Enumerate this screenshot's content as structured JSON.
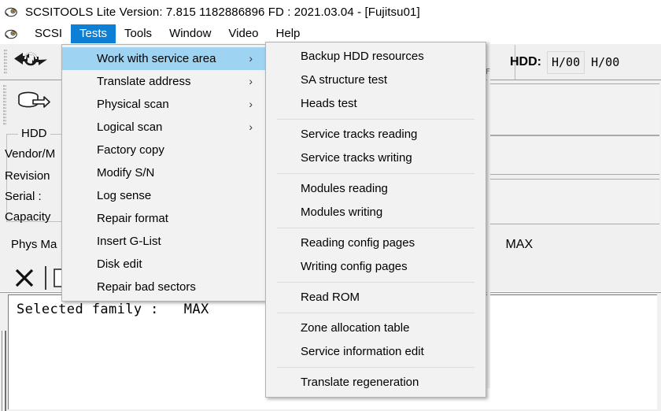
{
  "window": {
    "title": "SCSITOOLS Lite Version: 7.815   1182886896 FD : 2021.03.04 - [Fujitsu01]",
    "app_icon": "scsi-tools-icon",
    "accent_color": "#0d7fd4",
    "highlight_color": "#9fd3f2"
  },
  "menubar": {
    "icon": "scsi-tools-icon",
    "items": [
      {
        "label": "SCSI",
        "active": false
      },
      {
        "label": "Tests",
        "active": true
      },
      {
        "label": "Tools",
        "active": false
      },
      {
        "label": "Window",
        "active": false
      },
      {
        "label": "Video",
        "active": false
      },
      {
        "label": "Help",
        "active": false
      }
    ]
  },
  "toolbar": {
    "swap_icon": "double-arrow-swap-icon",
    "counter_digit": "3",
    "hdd_label": "HDD:",
    "hdd_value_1": "H/00",
    "hdd_value_2": "H/00"
  },
  "left_panel": {
    "drive_icon": "hdd-drive-icon",
    "group_title": "HDD",
    "fields": [
      {
        "label": "Vendor/M"
      },
      {
        "label": "Revision"
      },
      {
        "label": "Serial :"
      },
      {
        "label": "Capacity"
      }
    ],
    "phys_map_label": "Phys Ma"
  },
  "right_panel": {
    "selected_family_colon": ":",
    "selected_family_value": "MAX"
  },
  "action_bar": {
    "close_icon": "x-close-icon",
    "doc_icon": "document-icon"
  },
  "log": {
    "text": "Selected family :   MAX"
  },
  "menus": {
    "tests": {
      "items": [
        {
          "label": "Work with service area",
          "submenu": true,
          "highlighted": true,
          "separator_after": false
        },
        {
          "label": "Translate address",
          "submenu": true,
          "highlighted": false,
          "separator_after": false
        },
        {
          "label": "Physical scan",
          "submenu": true,
          "highlighted": false,
          "separator_after": false
        },
        {
          "label": "Logical scan",
          "submenu": true,
          "highlighted": false,
          "separator_after": false
        },
        {
          "label": "Factory copy",
          "submenu": false,
          "highlighted": false,
          "separator_after": false
        },
        {
          "label": "Modify S/N",
          "submenu": false,
          "highlighted": false,
          "separator_after": false
        },
        {
          "label": "Log sense",
          "submenu": false,
          "highlighted": false,
          "separator_after": false
        },
        {
          "label": "Repair format",
          "submenu": false,
          "highlighted": false,
          "separator_after": false
        },
        {
          "label": "Insert G-List",
          "submenu": false,
          "highlighted": false,
          "separator_after": false
        },
        {
          "label": "Disk edit",
          "submenu": false,
          "highlighted": false,
          "separator_after": false
        },
        {
          "label": "Repair bad sectors",
          "submenu": false,
          "highlighted": false,
          "separator_after": false
        }
      ]
    },
    "work_with_service_area": {
      "items": [
        {
          "label": "Backup HDD resources",
          "separator_after": false
        },
        {
          "label": "SA structure test",
          "separator_after": false
        },
        {
          "label": "Heads test",
          "separator_after": true
        },
        {
          "label": "Service tracks reading",
          "separator_after": false
        },
        {
          "label": "Service tracks writing",
          "separator_after": true
        },
        {
          "label": "Modules reading",
          "separator_after": false
        },
        {
          "label": "Modules writing",
          "separator_after": true
        },
        {
          "label": "Reading config pages",
          "separator_after": false
        },
        {
          "label": "Writing config pages",
          "separator_after": true
        },
        {
          "label": "Read ROM",
          "separator_after": true
        },
        {
          "label": "Zone allocation table",
          "separator_after": false
        },
        {
          "label": "Service information edit",
          "separator_after": true
        },
        {
          "label": "Translate regeneration",
          "separator_after": false
        }
      ]
    }
  }
}
